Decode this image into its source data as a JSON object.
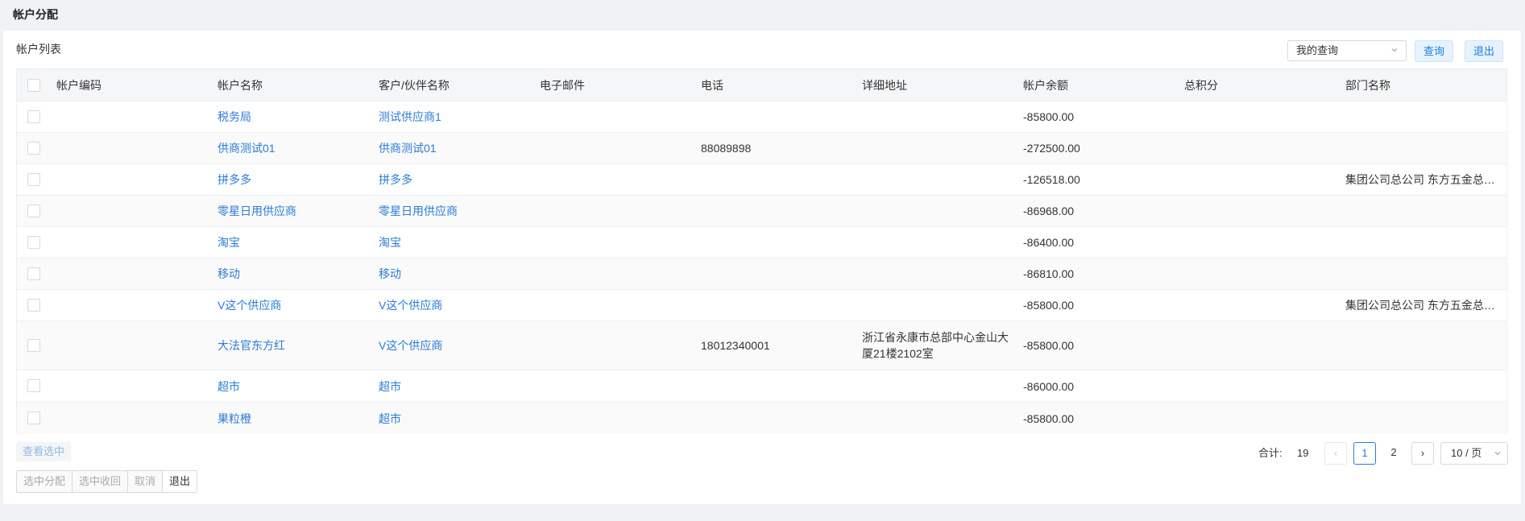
{
  "page": {
    "title": "帐户分配"
  },
  "list": {
    "title": "帐户列表"
  },
  "toolbar": {
    "query_select": "我的查询",
    "query_button": "查询",
    "exit_button": "退出"
  },
  "table": {
    "columns": [
      "帐户编码",
      "帐户名称",
      "客户/伙伴名称",
      "电子邮件",
      "电话",
      "详细地址",
      "帐户余额",
      "总积分",
      "部门名称"
    ],
    "rows": [
      {
        "code": "",
        "name": "税务局",
        "partner": "测试供应商1",
        "email": "",
        "phone": "",
        "address": "",
        "balance": "-85800.00",
        "points": "",
        "dept": ""
      },
      {
        "code": "",
        "name": "供商测试01",
        "partner": "供商测试01",
        "email": "",
        "phone": "88089898",
        "address": "",
        "balance": "-272500.00",
        "points": "",
        "dept": ""
      },
      {
        "code": "",
        "name": "拼多多",
        "partner": "拼多多",
        "email": "",
        "phone": "",
        "address": "",
        "balance": "-126518.00",
        "points": "",
        "dept": "集团公司总公司 东方五金总公司"
      },
      {
        "code": "",
        "name": "零星日用供应商",
        "partner": "零星日用供应商",
        "email": "",
        "phone": "",
        "address": "",
        "balance": "-86968.00",
        "points": "",
        "dept": ""
      },
      {
        "code": "",
        "name": "淘宝",
        "partner": "淘宝",
        "email": "",
        "phone": "",
        "address": "",
        "balance": "-86400.00",
        "points": "",
        "dept": ""
      },
      {
        "code": "",
        "name": "移动",
        "partner": "移动",
        "email": "",
        "phone": "",
        "address": "",
        "balance": "-86810.00",
        "points": "",
        "dept": ""
      },
      {
        "code": "",
        "name": "V这个供应商",
        "partner": "V这个供应商",
        "email": "",
        "phone": "",
        "address": "",
        "balance": "-85800.00",
        "points": "",
        "dept": "集团公司总公司 东方五金总公司"
      },
      {
        "code": "",
        "name": "大法官东方红",
        "partner": "V这个供应商",
        "email": "",
        "phone": "18012340001",
        "address": "浙江省永康市总部中心金山大厦21楼2102室",
        "balance": "-85800.00",
        "points": "",
        "dept": ""
      },
      {
        "code": "",
        "name": "超市",
        "partner": "超市",
        "email": "",
        "phone": "",
        "address": "",
        "balance": "-86000.00",
        "points": "",
        "dept": ""
      },
      {
        "code": "",
        "name": "果粒橙",
        "partner": "超市",
        "email": "",
        "phone": "",
        "address": "",
        "balance": "-85800.00",
        "points": "",
        "dept": ""
      }
    ]
  },
  "footer": {
    "view_selected": "查看选中",
    "actions": [
      "选中分配",
      "选中收回",
      "取消",
      "退出"
    ]
  },
  "pagination": {
    "total_label": "合计:",
    "total": "19",
    "prev": "‹",
    "pages": [
      "1",
      "2"
    ],
    "current": "1",
    "next": "›",
    "page_size": "10 / 页"
  },
  "colors": {
    "link": "#2b7bd8",
    "accent_bg": "#e6f2ff"
  }
}
